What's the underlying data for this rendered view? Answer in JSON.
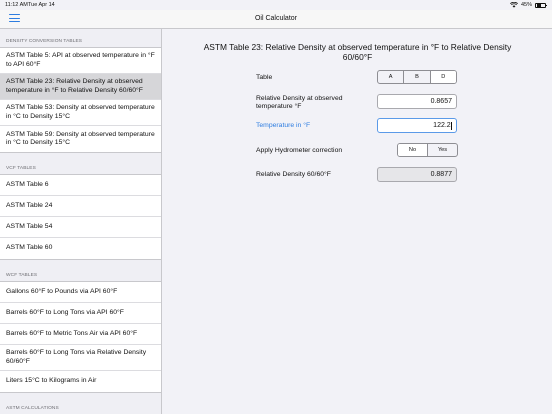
{
  "status": {
    "time": "11:12 AM",
    "date": "Tue Apr 14",
    "battery": "45%"
  },
  "nav": {
    "title": "Oil Calculator"
  },
  "sidebar": {
    "sections": [
      {
        "header": "DENSITY CONVERSION TABLES",
        "items": [
          {
            "label": "ASTM Table 5: API at observed temperature in °F to API 60°F"
          },
          {
            "label": "ASTM Table 23: Relative Density at observed temperature in °F to Relative Density 60/60°F",
            "selected": true
          },
          {
            "label": "ASTM Table 53: Density at observed temperature in °C to Density 15°C"
          },
          {
            "label": "ASTM Table 59: Density at observed temperature in °C to Density 15°C"
          }
        ]
      },
      {
        "header": "VCF TABLES",
        "items": [
          {
            "label": "ASTM Table 6"
          },
          {
            "label": "ASTM Table 24"
          },
          {
            "label": "ASTM Table 54"
          },
          {
            "label": "ASTM Table 60"
          }
        ]
      },
      {
        "header": "WCF TABLES",
        "items": [
          {
            "label": "Gallons 60°F to Pounds via API 60°F"
          },
          {
            "label": "Barrels 60°F to Long Tons via API 60°F"
          },
          {
            "label": "Barrels 60°F to Metric Tons Air via API 60°F"
          },
          {
            "label": "Barrels 60°F to Long Tons via Relative Density 60/60°F"
          },
          {
            "label": "Liters 15°C to Kilograms in Air"
          }
        ]
      },
      {
        "header": "ASTM CALCULATIONS",
        "items": []
      }
    ]
  },
  "main": {
    "heading": "ASTM Table 23: Relative Density at observed temperature in °F to Relative Density 60/60°F",
    "table_label": "Table",
    "table_options": [
      "A",
      "B",
      "D"
    ],
    "table_selected": "D",
    "rd_label": "Relative Density at observed temperature °F",
    "rd_value": "0.8657",
    "temp_label": "Temperature in °F",
    "temp_value": "122.2",
    "hydro_label": "Apply Hydrometer correction",
    "hydro_options": [
      "No",
      "Yes"
    ],
    "hydro_selected": "No",
    "result_label": "Relative Density 60/60°F",
    "result_value": "0.8877"
  }
}
